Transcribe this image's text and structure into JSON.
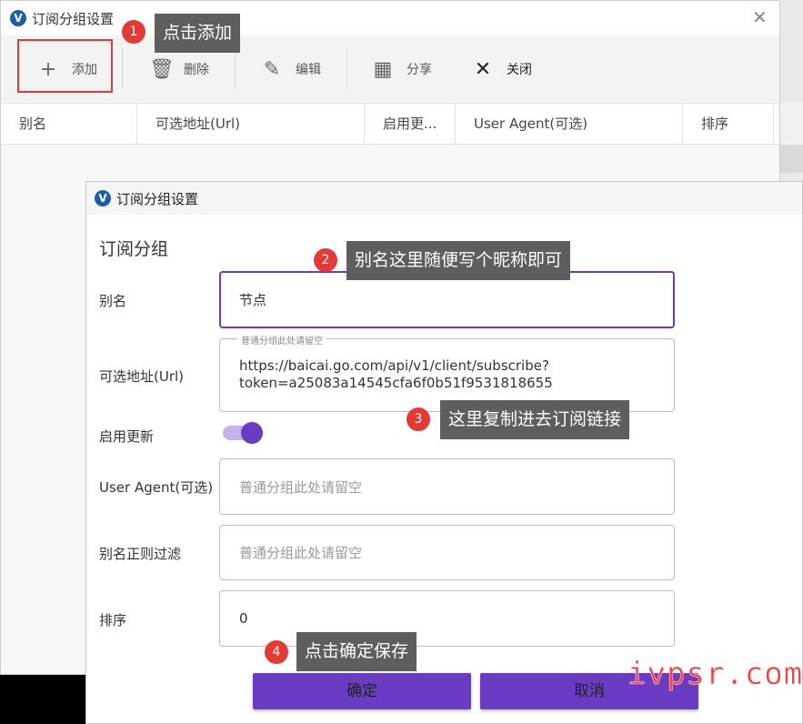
{
  "back_window": {
    "title": "订阅分组设置",
    "close_glyph": "✕",
    "logo_glyph": "V",
    "toolbar": {
      "add": {
        "label": "添加",
        "icon": "plus-icon",
        "glyph": "+"
      },
      "delete": {
        "label": "删除",
        "icon": "trash-icon",
        "glyph": "🗑"
      },
      "edit": {
        "label": "编辑",
        "icon": "pencil-icon",
        "glyph": "✎"
      },
      "share": {
        "label": "分享",
        "icon": "qr-code-icon",
        "glyph": "▦"
      },
      "close": {
        "label": "关闭",
        "icon": "close-icon",
        "glyph": "✕"
      }
    },
    "table": {
      "columns": [
        "别名",
        "可选地址(Url)",
        "启用更...",
        "User Agent(可选)",
        "排序"
      ],
      "rows": []
    }
  },
  "dialog": {
    "title": "订阅分组设置",
    "logo_glyph": "V",
    "section_title": "订阅分组",
    "fields": {
      "alias": {
        "label": "别名",
        "value": "节点"
      },
      "url": {
        "label": "可选地址(Url)",
        "hint": "普通分组此处请留空",
        "value_line1": "https://baicai.go.com/api/v1/client/subscribe?",
        "value_line2": "token=a25083a14545cfa6f0b51f9531818655"
      },
      "auto_update": {
        "label": "启用更新",
        "enabled": true
      },
      "user_agent": {
        "label": "User Agent(可选)",
        "placeholder": "普通分组此处请留空"
      },
      "alias_regex": {
        "label": "别名正则过滤",
        "placeholder": "普通分组此处请留空"
      },
      "sort": {
        "label": "排序",
        "value": "0"
      }
    },
    "buttons": {
      "ok": "确定",
      "cancel": "取消"
    }
  },
  "annotations": [
    {
      "number": "1",
      "text": "点击添加"
    },
    {
      "number": "2",
      "text": "别名这里随便写个昵称即可"
    },
    {
      "number": "3",
      "text": "这里复制进去订阅链接"
    },
    {
      "number": "4",
      "text": "点击确定保存"
    }
  ],
  "watermark": "ivpsr.com",
  "colors": {
    "accent": "#6a3cc4",
    "annotation_red": "#e53935",
    "switch_track": "#c6b2ea"
  }
}
